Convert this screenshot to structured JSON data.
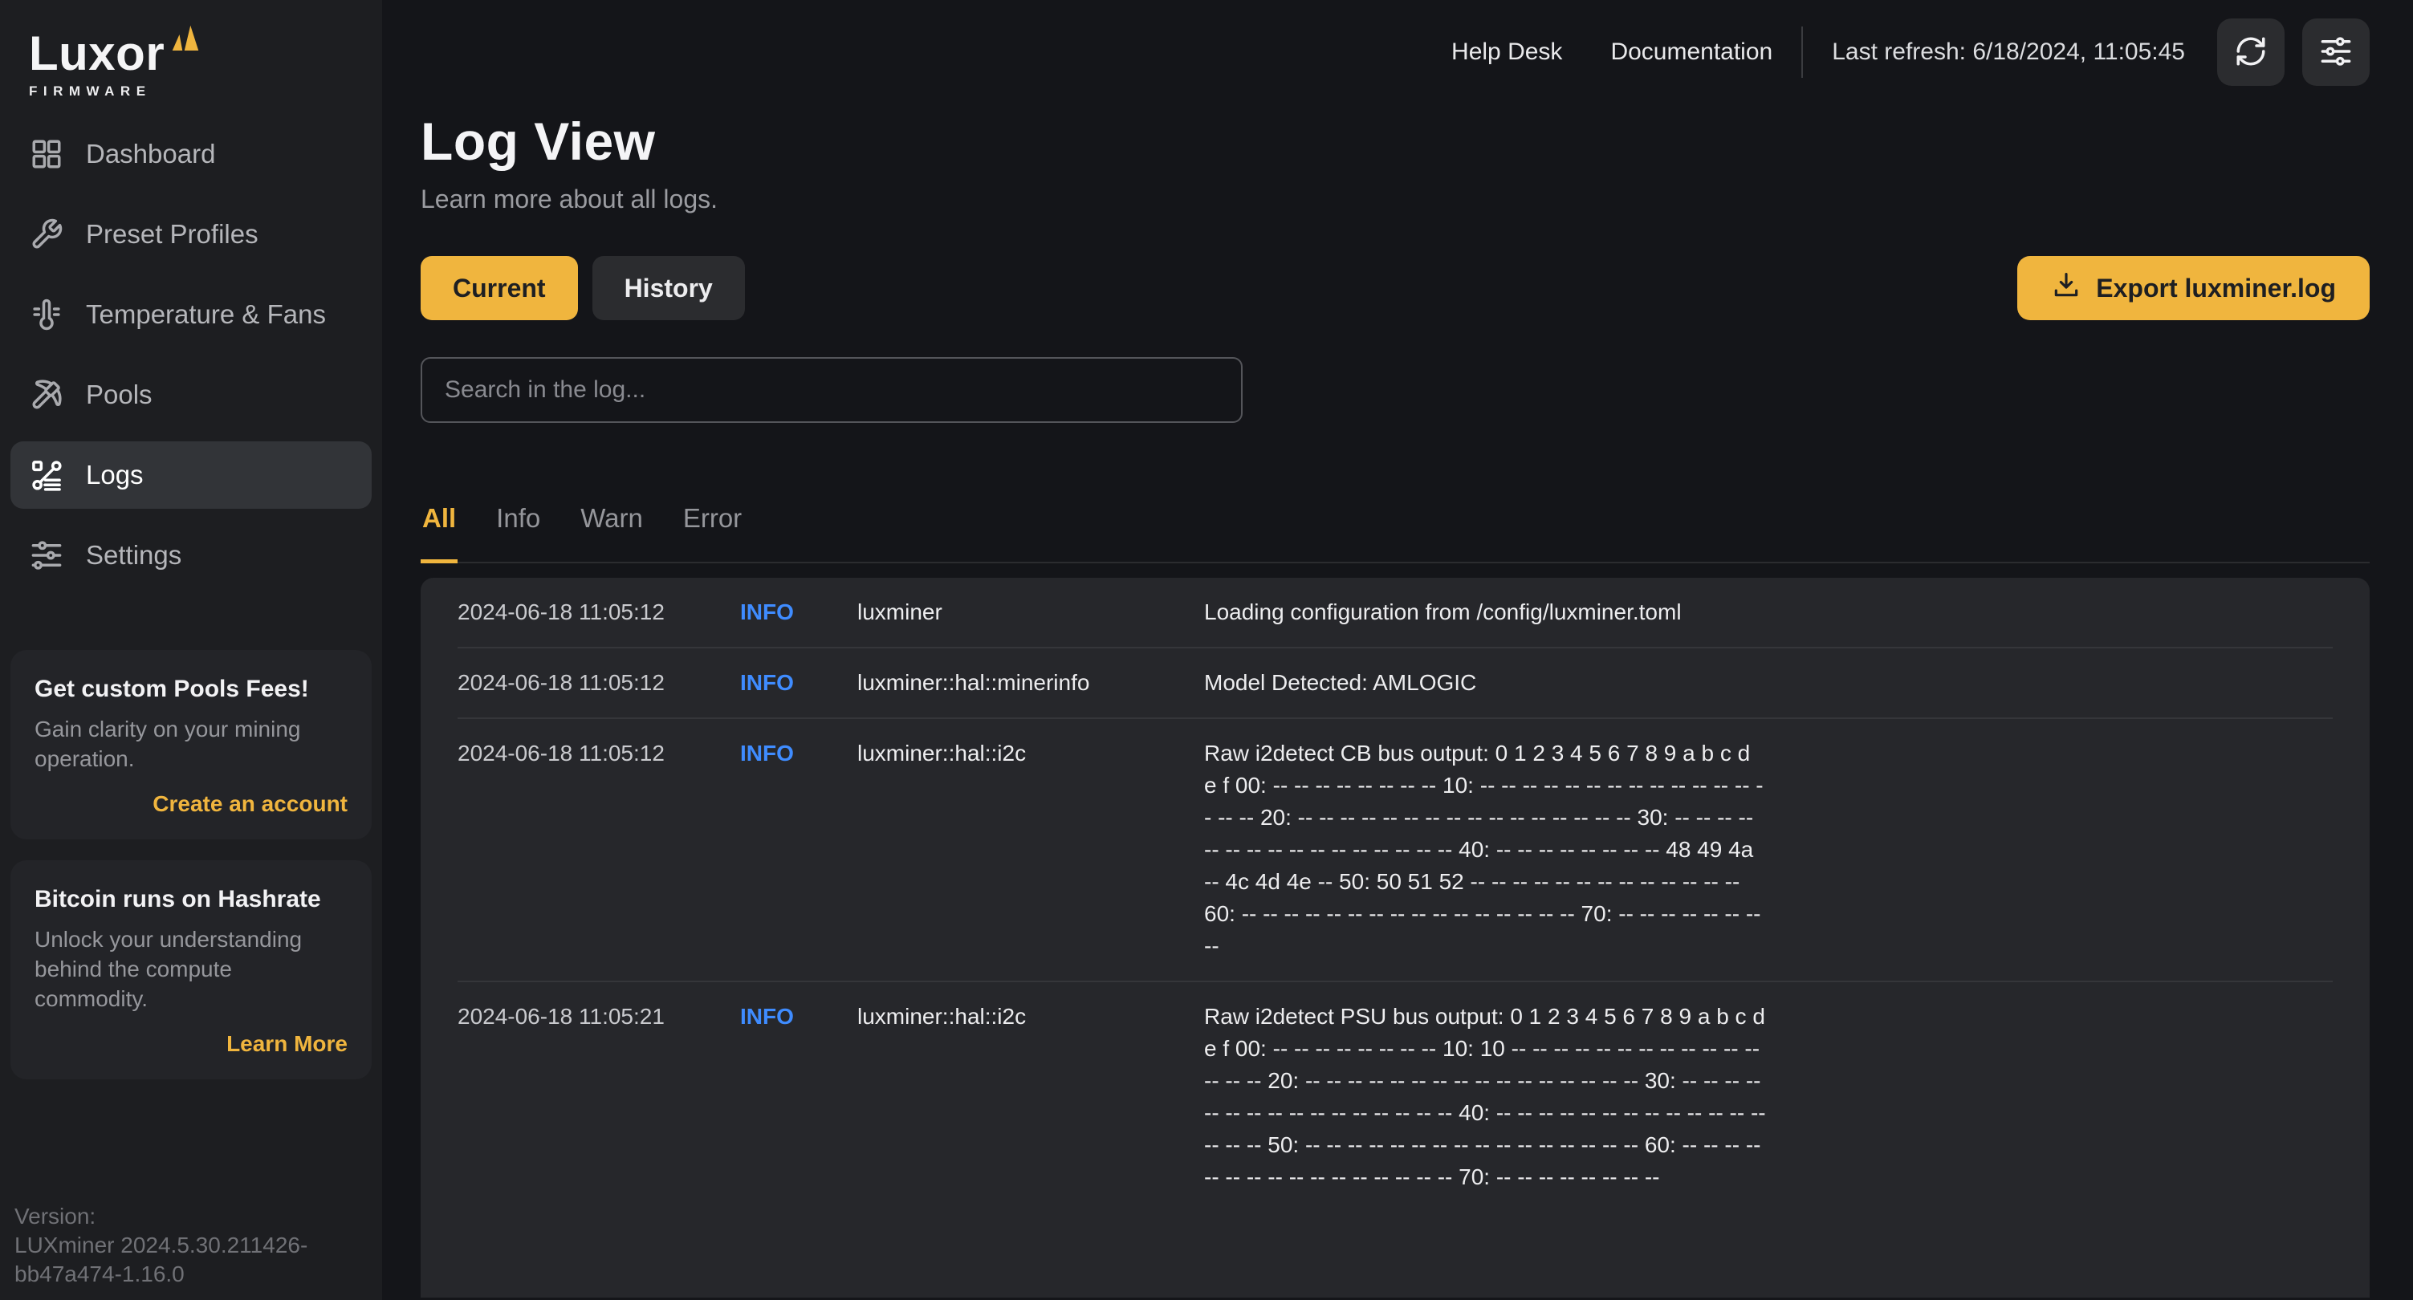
{
  "brand": {
    "name": "Luxor",
    "sub": "FIRMWARE"
  },
  "sidebar": {
    "items": [
      {
        "label": "Dashboard",
        "icon": "grid-icon",
        "active": false
      },
      {
        "label": "Preset Profiles",
        "icon": "wrench-icon",
        "active": false
      },
      {
        "label": "Temperature & Fans",
        "icon": "thermometer-icon",
        "active": false
      },
      {
        "label": "Pools",
        "icon": "pickaxe-icon",
        "active": false
      },
      {
        "label": "Logs",
        "icon": "logs-flow-icon",
        "active": true
      },
      {
        "label": "Settings",
        "icon": "sliders-icon",
        "active": false
      }
    ],
    "promos": [
      {
        "title": "Get custom Pools Fees!",
        "body": "Gain clarity on your mining operation.",
        "cta": "Create an account"
      },
      {
        "title": "Bitcoin runs on Hashrate",
        "body": "Unlock your understanding behind the compute commodity.",
        "cta": "Learn More"
      }
    ],
    "version_label": "Version:",
    "version_value": "LUXminer 2024.5.30.211426-bb47a474-1.16.0"
  },
  "topbar": {
    "links": [
      "Help Desk",
      "Documentation"
    ],
    "last_refresh": "Last refresh: 6/18/2024, 11:05:45"
  },
  "page": {
    "title": "Log View",
    "subtitle": "Learn more about all logs."
  },
  "view_tabs": [
    {
      "label": "Current",
      "active": true
    },
    {
      "label": "History",
      "active": false
    }
  ],
  "export_button": {
    "label": "Export luxminer.log"
  },
  "search": {
    "placeholder": "Search in the log..."
  },
  "filter_tabs": [
    {
      "label": "All",
      "active": true
    },
    {
      "label": "Info",
      "active": false
    },
    {
      "label": "Warn",
      "active": false
    },
    {
      "label": "Error",
      "active": false
    }
  ],
  "log_rows": [
    {
      "timestamp": "2024-06-18 11:05:12",
      "level": "INFO",
      "source": "luxminer",
      "message": "Loading configuration from /config/luxminer.toml"
    },
    {
      "timestamp": "2024-06-18 11:05:12",
      "level": "INFO",
      "source": "luxminer::hal::minerinfo",
      "message": "Model Detected: AMLOGIC"
    },
    {
      "timestamp": "2024-06-18 11:05:12",
      "level": "INFO",
      "source": "luxminer::hal::i2c",
      "message": "Raw i2detect CB bus output: 0 1 2 3 4 5 6 7 8 9 a b c d e f 00: -- -- -- -- -- -- -- -- 10: -- -- -- -- -- -- -- -- -- -- -- -- -- -- -- -- 20: -- -- -- -- -- -- -- -- -- -- -- -- -- -- -- -- 30: -- -- -- -- -- -- -- -- -- -- -- -- -- -- -- -- 40: -- -- -- -- -- -- -- -- 48 49 4a -- 4c 4d 4e -- 50: 50 51 52 -- -- -- -- -- -- -- -- -- -- -- -- -- 60: -- -- -- -- -- -- -- -- -- -- -- -- -- -- -- -- 70: -- -- -- -- -- -- -- --"
    },
    {
      "timestamp": "2024-06-18 11:05:21",
      "level": "INFO",
      "source": "luxminer::hal::i2c",
      "message": "Raw i2detect PSU bus output: 0 1 2 3 4 5 6 7 8 9 a b c d e f 00: -- -- -- -- -- -- -- -- 10: 10 -- -- -- -- -- -- -- -- -- -- -- -- -- -- -- 20: -- -- -- -- -- -- -- -- -- -- -- -- -- -- -- -- 30: -- -- -- -- -- -- -- -- -- -- -- -- -- -- -- -- 40: -- -- -- -- -- -- -- -- -- -- -- -- -- -- -- -- 50: -- -- -- -- -- -- -- -- -- -- -- -- -- -- -- -- 60: -- -- -- -- -- -- -- -- -- -- -- -- -- -- -- -- 70: -- -- -- -- -- -- -- --"
    }
  ],
  "colors": {
    "accent": "#F0B53E",
    "info_level": "#3F8CFF",
    "sidebar_bg": "#1D1E21",
    "main_bg": "#141519",
    "table_bg": "#26272B"
  }
}
